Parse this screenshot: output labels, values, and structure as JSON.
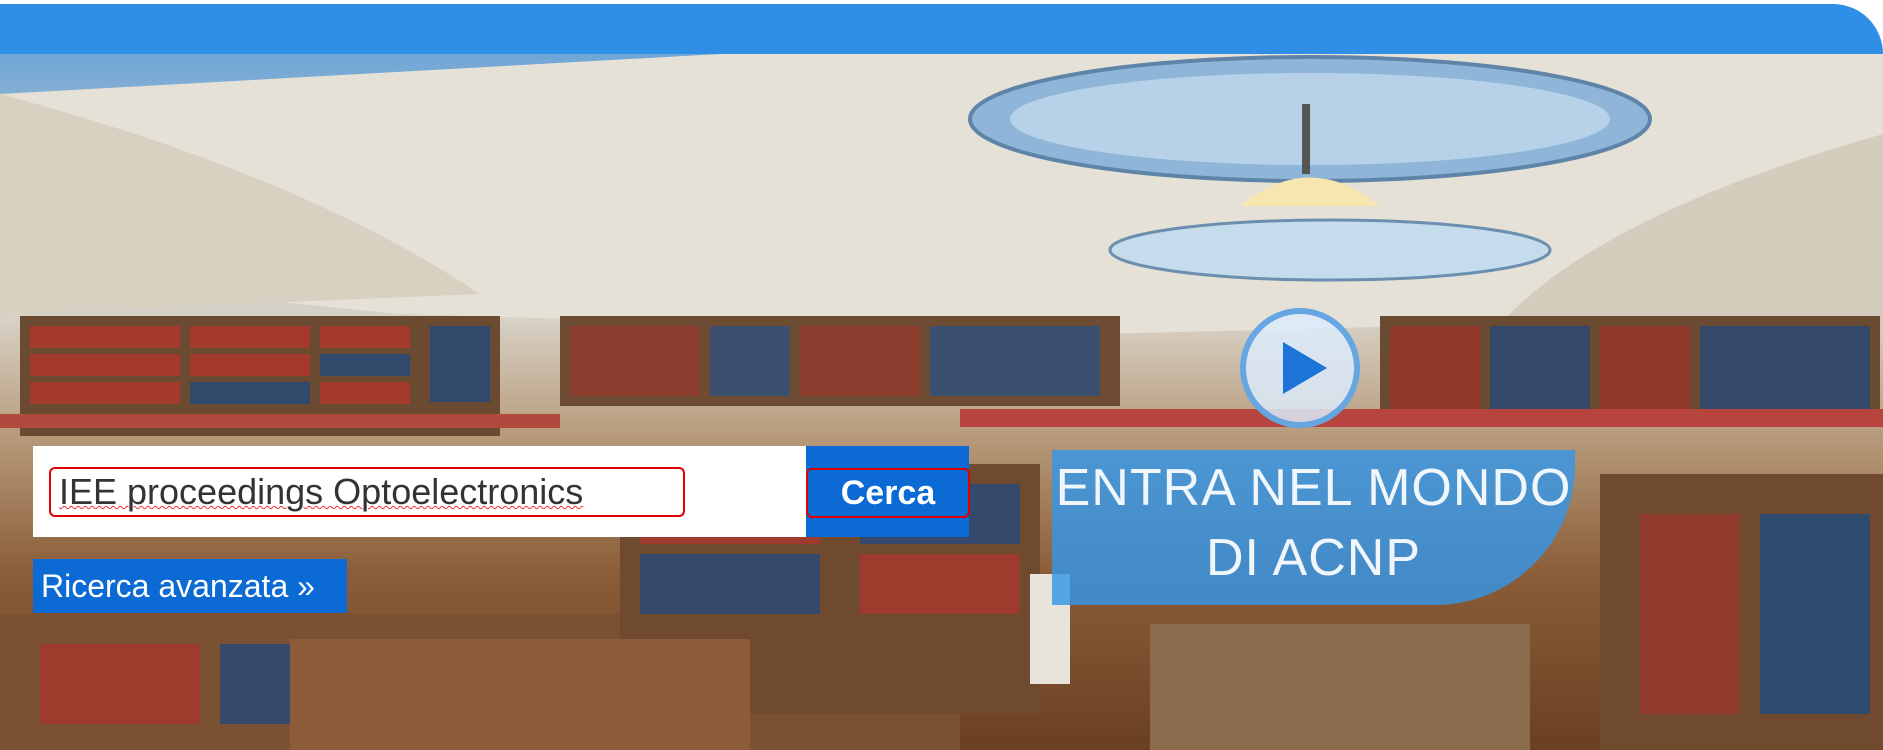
{
  "search": {
    "query": "IEE proceedings Optoelectronics",
    "button_label": "Cerca"
  },
  "advanced_search": {
    "label": "Ricerca avanzata »"
  },
  "promo": {
    "line1": "ENTRA NEL MONDO",
    "line2": "DI ACNP"
  },
  "icons": {
    "play": "play-icon"
  },
  "colors": {
    "top_bar": "#2f8fe6",
    "button_blue": "#0b6ad3",
    "promo_blue": "#3496e8",
    "highlight_red": "#e00000"
  }
}
